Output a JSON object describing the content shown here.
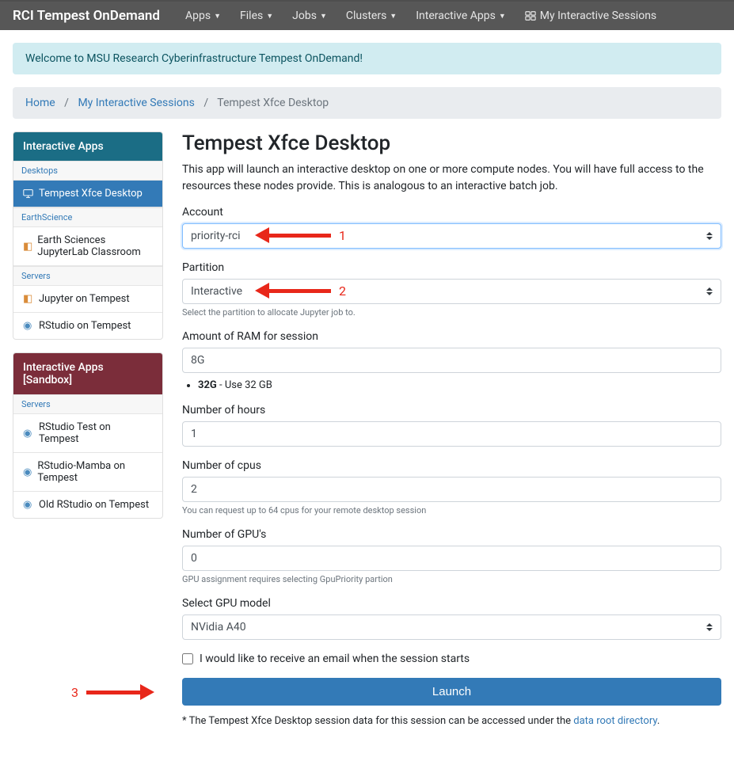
{
  "navbar": {
    "brand": "RCI Tempest OnDemand",
    "items": [
      {
        "label": "Apps",
        "dropdown": true
      },
      {
        "label": "Files",
        "dropdown": true
      },
      {
        "label": "Jobs",
        "dropdown": true
      },
      {
        "label": "Clusters",
        "dropdown": true
      },
      {
        "label": "Interactive Apps",
        "dropdown": true
      },
      {
        "label": "My Interactive Sessions",
        "dropdown": false,
        "icon": "sessions"
      }
    ]
  },
  "alert": "Welcome to MSU Research Cyberinfrastructure Tempest OnDemand!",
  "breadcrumb": {
    "items": [
      {
        "label": "Home",
        "link": true
      },
      {
        "label": "My Interactive Sessions",
        "link": true
      },
      {
        "label": "Tempest Xfce Desktop",
        "link": false
      }
    ]
  },
  "sidebar1": {
    "title": "Interactive Apps",
    "groups": [
      {
        "header": "Desktops",
        "items": [
          {
            "label": "Tempest Xfce Desktop",
            "icon": "desktop",
            "active": true
          }
        ]
      },
      {
        "header": "EarthScience",
        "items": [
          {
            "label": "Earth Sciences JupyterLab Classroom",
            "icon": "notebook"
          }
        ]
      },
      {
        "header": "Servers",
        "items": [
          {
            "label": "Jupyter on Tempest",
            "icon": "notebook"
          },
          {
            "label": "RStudio on Tempest",
            "icon": "rstudio"
          }
        ]
      }
    ]
  },
  "sidebar2": {
    "title": "Interactive Apps [Sandbox]",
    "groups": [
      {
        "header": "Servers",
        "items": [
          {
            "label": "RStudio Test on Tempest",
            "icon": "rstudio"
          },
          {
            "label": "RStudio-Mamba on Tempest",
            "icon": "rstudio"
          },
          {
            "label": "Old RStudio on Tempest",
            "icon": "rstudio"
          }
        ]
      }
    ]
  },
  "page": {
    "title": "Tempest Xfce Desktop",
    "description": "This app will launch an interactive desktop on one or more compute nodes. You will have full access to the resources these nodes provide. This is analogous to an interactive batch job."
  },
  "form": {
    "account": {
      "label": "Account",
      "value": "priority-rci"
    },
    "partition": {
      "label": "Partition",
      "value": "Interactive",
      "help": "Select the partition to allocate Jupyter job to."
    },
    "ram": {
      "label": "Amount of RAM for session",
      "value": "8G",
      "hint_bold": "32G",
      "hint_rest": " - Use 32 GB"
    },
    "hours": {
      "label": "Number of hours",
      "value": "1"
    },
    "cpus": {
      "label": "Number of cpus",
      "value": "2",
      "help": "You can request up to 64 cpus for your remote desktop session"
    },
    "gpus": {
      "label": "Number of GPU's",
      "value": "0",
      "help": "GPU assignment requires selecting GpuPriority partion"
    },
    "gpu_model": {
      "label": "Select GPU model",
      "value": "NVidia A40"
    },
    "email": {
      "label": "I would like to receive an email when the session starts"
    },
    "launch": "Launch"
  },
  "footnote": {
    "prefix": "* The Tempest Xfce Desktop session data for this session can be accessed under the ",
    "link": "data root directory",
    "suffix": "."
  },
  "annotations": {
    "a1": "1",
    "a2": "2",
    "a3": "3"
  }
}
